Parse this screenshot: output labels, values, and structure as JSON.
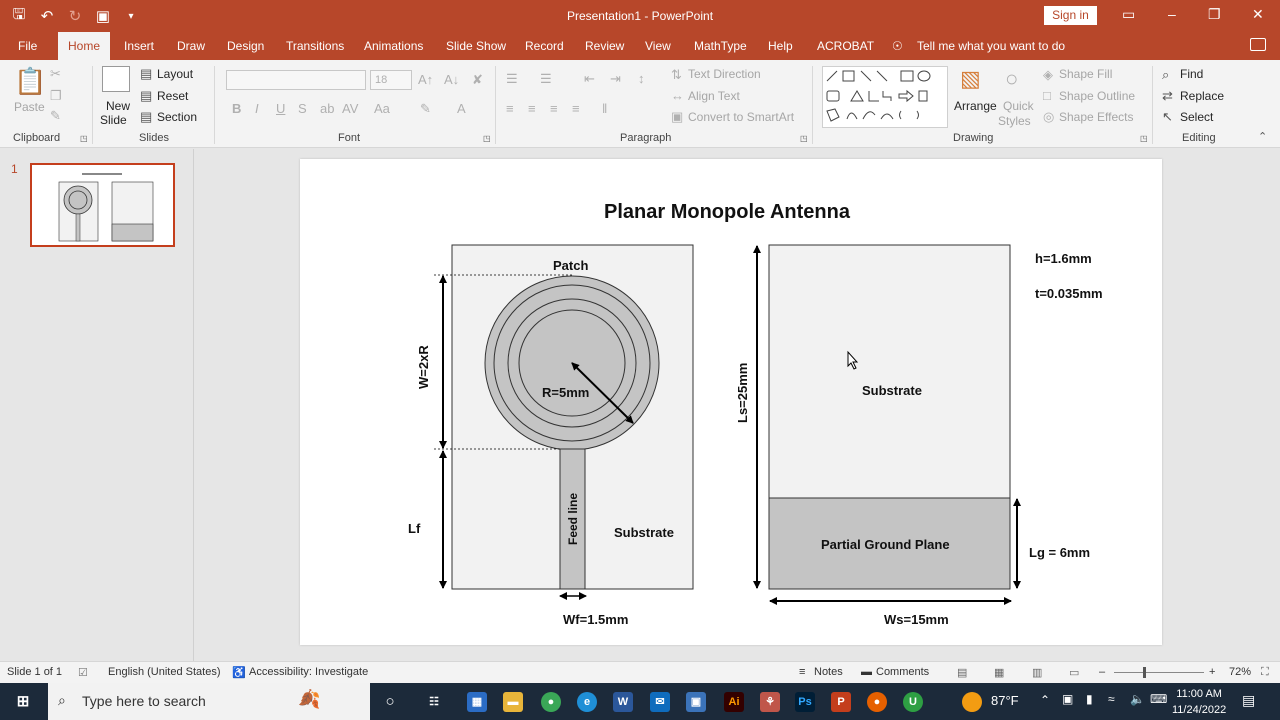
{
  "app": {
    "title": "Presentation1  -  PowerPoint",
    "sign_in": "Sign in"
  },
  "tabs": [
    "File",
    "Home",
    "Insert",
    "Draw",
    "Design",
    "Transitions",
    "Animations",
    "Slide Show",
    "Record",
    "Review",
    "View",
    "MathType",
    "Help",
    "ACROBAT"
  ],
  "active_tab": "Home",
  "tell_me": "Tell me what you want to do",
  "ribbon": {
    "clipboard": {
      "label": "Clipboard",
      "paste": "Paste"
    },
    "slides": {
      "label": "Slides",
      "new_slide": "New",
      "new_slide2": "Slide",
      "layout": "Layout",
      "reset": "Reset",
      "section": "Section"
    },
    "font": {
      "label": "Font",
      "size": "18"
    },
    "paragraph": {
      "label": "Paragraph",
      "text_direction": "Text Direction",
      "align_text": "Align Text",
      "convert_smartart": "Convert to SmartArt"
    },
    "drawing": {
      "label": "Drawing",
      "arrange": "Arrange",
      "quick_styles": "Quick",
      "quick_styles2": "Styles",
      "shape_fill": "Shape Fill",
      "shape_outline": "Shape Outline",
      "shape_effects": "Shape Effects"
    },
    "editing": {
      "label": "Editing",
      "find": "Find",
      "replace": "Replace",
      "select": "Select"
    }
  },
  "thumbnail": {
    "number": "1"
  },
  "slide": {
    "title": "Planar Monopole Antenna",
    "patch": "Patch",
    "w": "W=2xR",
    "r": "R=5mm",
    "feed_line": "Feed line",
    "substrate_left": "Substrate",
    "lf": "Lf",
    "wf": "Wf=1.5mm",
    "ls": "Ls=25mm",
    "substrate_right": "Substrate",
    "ground": "Partial Ground Plane",
    "lg": "Lg = 6mm",
    "ws": "Ws=15mm",
    "h": "h=1.6mm",
    "t": "t=0.035mm"
  },
  "status": {
    "slide_of": "Slide 1 of 1",
    "language": "English (United States)",
    "accessibility": "Accessibility: Investigate",
    "notes": "Notes",
    "comments": "Comments",
    "zoom": "72%"
  },
  "taskbar": {
    "search": "Type here to search",
    "temp": "87°F",
    "time": "11:00 AM",
    "date": "11/24/2022"
  },
  "colors": {
    "accent": "#b7472a",
    "substrate": "#f2f2f2",
    "metal": "#c4c4c4"
  }
}
